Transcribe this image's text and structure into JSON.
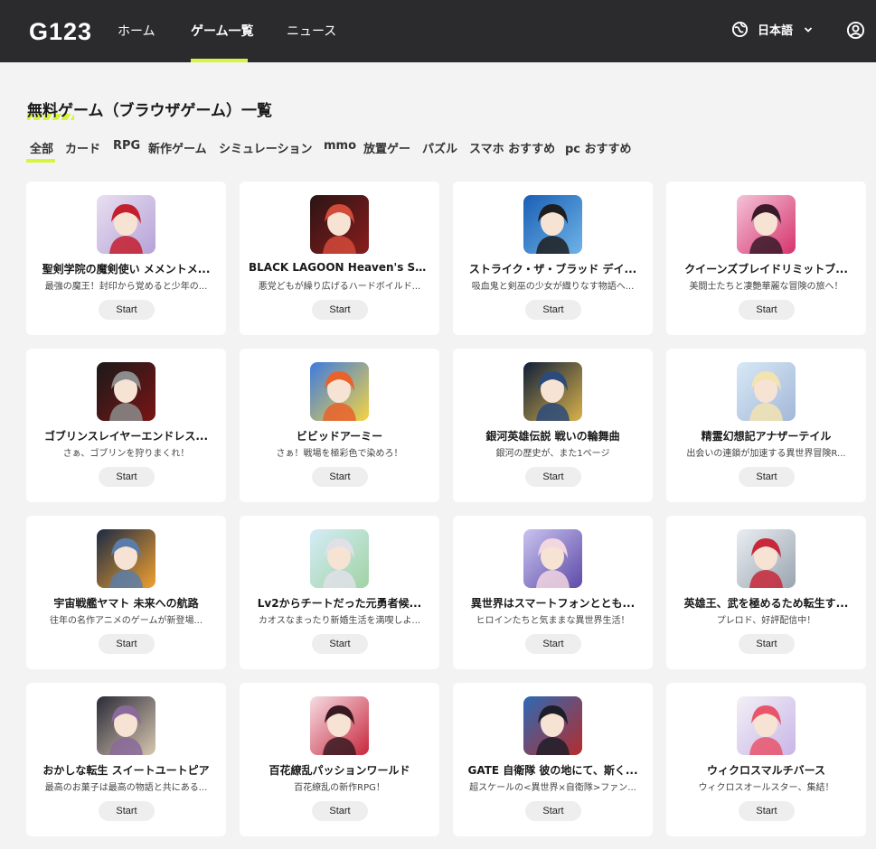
{
  "header": {
    "logo": "G123",
    "nav": [
      {
        "label": "ホーム",
        "active": false
      },
      {
        "label": "ゲーム一覧",
        "active": true
      },
      {
        "label": "ニュース",
        "active": false
      }
    ],
    "language": "日本語",
    "accent": "#d7f53c",
    "background": "#2b2b2e"
  },
  "page": {
    "title": "無料ゲーム（ブラウザゲーム）一覧"
  },
  "filters": [
    {
      "label": "全部",
      "active": true
    },
    {
      "label": "カード",
      "active": false
    },
    {
      "label": "RPG",
      "active": false
    },
    {
      "label": "新作ゲーム",
      "active": false
    },
    {
      "label": "シミュレーション",
      "active": false
    },
    {
      "label": "mmo",
      "active": false
    },
    {
      "label": "放置ゲー",
      "active": false
    },
    {
      "label": "パズル",
      "active": false
    },
    {
      "label": "スマホ おすすめ",
      "active": false
    },
    {
      "label": "pc おすすめ",
      "active": false
    }
  ],
  "games": [
    {
      "title": "聖剣学院の魔剣使い メメントメ...",
      "desc": "最強の魔王！封印から覚めると少年の...",
      "button": "Start",
      "colors": [
        "#e9dff0",
        "#b5a2d8",
        "#c41f2f"
      ]
    },
    {
      "title": "BLACK LAGOON Heaven's Shot",
      "desc": "悪党どもが繰り広げるハードボイルド...",
      "button": "Start",
      "colors": [
        "#2a1414",
        "#8a1d1d",
        "#d14a3a"
      ]
    },
    {
      "title": "ストライク・ザ・ブラッド デイ...",
      "desc": "吸血鬼と剣巫の少女が織りなす物語へ...",
      "button": "Start",
      "colors": [
        "#1a5fb4",
        "#6fb3e8",
        "#1e1e1e"
      ]
    },
    {
      "title": "クイーンズブレイドリミットブ...",
      "desc": "美闘士たちと凄艶華麗な冒険の旅へ！",
      "button": "Start",
      "colors": [
        "#f4c3d8",
        "#d6336c",
        "#3a1a2a"
      ]
    },
    {
      "title": "ゴブリンスレイヤーエンドレス...",
      "desc": "さぁ、ゴブリンを狩りまくれ！",
      "button": "Start",
      "colors": [
        "#1a1a1a",
        "#7a1414",
        "#8c8c8c"
      ]
    },
    {
      "title": "ビビッドアーミー",
      "desc": "さぁ！戦場を極彩色で染めろ！",
      "button": "Start",
      "colors": [
        "#3d7be0",
        "#f5d442",
        "#e8622c"
      ]
    },
    {
      "title": "銀河英雄伝説 戦いの輪舞曲",
      "desc": "銀河の歴史が、また1ページ",
      "button": "Start",
      "colors": [
        "#0f1e3a",
        "#d9b24a",
        "#2c4a7a"
      ]
    },
    {
      "title": "精霊幻想記アナザーテイル",
      "desc": "出会いの連鎖が加速する異世界冒険R...",
      "button": "Start",
      "colors": [
        "#d7e8f5",
        "#a3b8d9",
        "#f2e3b0"
      ]
    },
    {
      "title": "宇宙戦艦ヤマト 未来への航路",
      "desc": "往年の名作アニメのゲームが新登場...",
      "button": "Start",
      "colors": [
        "#1b2a44",
        "#f0a030",
        "#5a7ca8"
      ]
    },
    {
      "title": "Lv2からチートだった元勇者候...",
      "desc": "カオスなまったり新婚生活を満喫しよ...",
      "button": "Start",
      "colors": [
        "#d5ecf7",
        "#9fd3a4",
        "#e0e0e8"
      ]
    },
    {
      "title": "異世界はスマートフォンととも...",
      "desc": "ヒロインたちと気ままな異世界生活！",
      "button": "Start",
      "colors": [
        "#c9c4f0",
        "#5e4aa8",
        "#f2d6e0"
      ]
    },
    {
      "title": "英雄王、武を極めるため転生す...",
      "desc": "プレロド、好評配信中！",
      "button": "Start",
      "colors": [
        "#e9eef2",
        "#9aa4b0",
        "#c7283a"
      ]
    },
    {
      "title": "おかしな転生 スイートユートピア",
      "desc": "最高のお菓子は最高の物語と共にある...",
      "button": "Start",
      "colors": [
        "#2a2a38",
        "#d7c7b0",
        "#8a6a9a"
      ]
    },
    {
      "title": "百花繚乱パッションワールド",
      "desc": "百花繚乱の新作RPG！",
      "button": "Start",
      "colors": [
        "#f5dde4",
        "#c8273d",
        "#3a1a22"
      ]
    },
    {
      "title": "GATE 自衛隊 彼の地にて、斯く...",
      "desc": "超スケールの<異世界×自衛隊>ファン...",
      "button": "Start",
      "colors": [
        "#2c6ab5",
        "#b52c2c",
        "#1e1e2a"
      ]
    },
    {
      "title": "ウィクロスマルチバース",
      "desc": "ウィクロスオールスター、集結！",
      "button": "Start",
      "colors": [
        "#f2f0f5",
        "#c9b5e8",
        "#e8556b"
      ]
    }
  ]
}
